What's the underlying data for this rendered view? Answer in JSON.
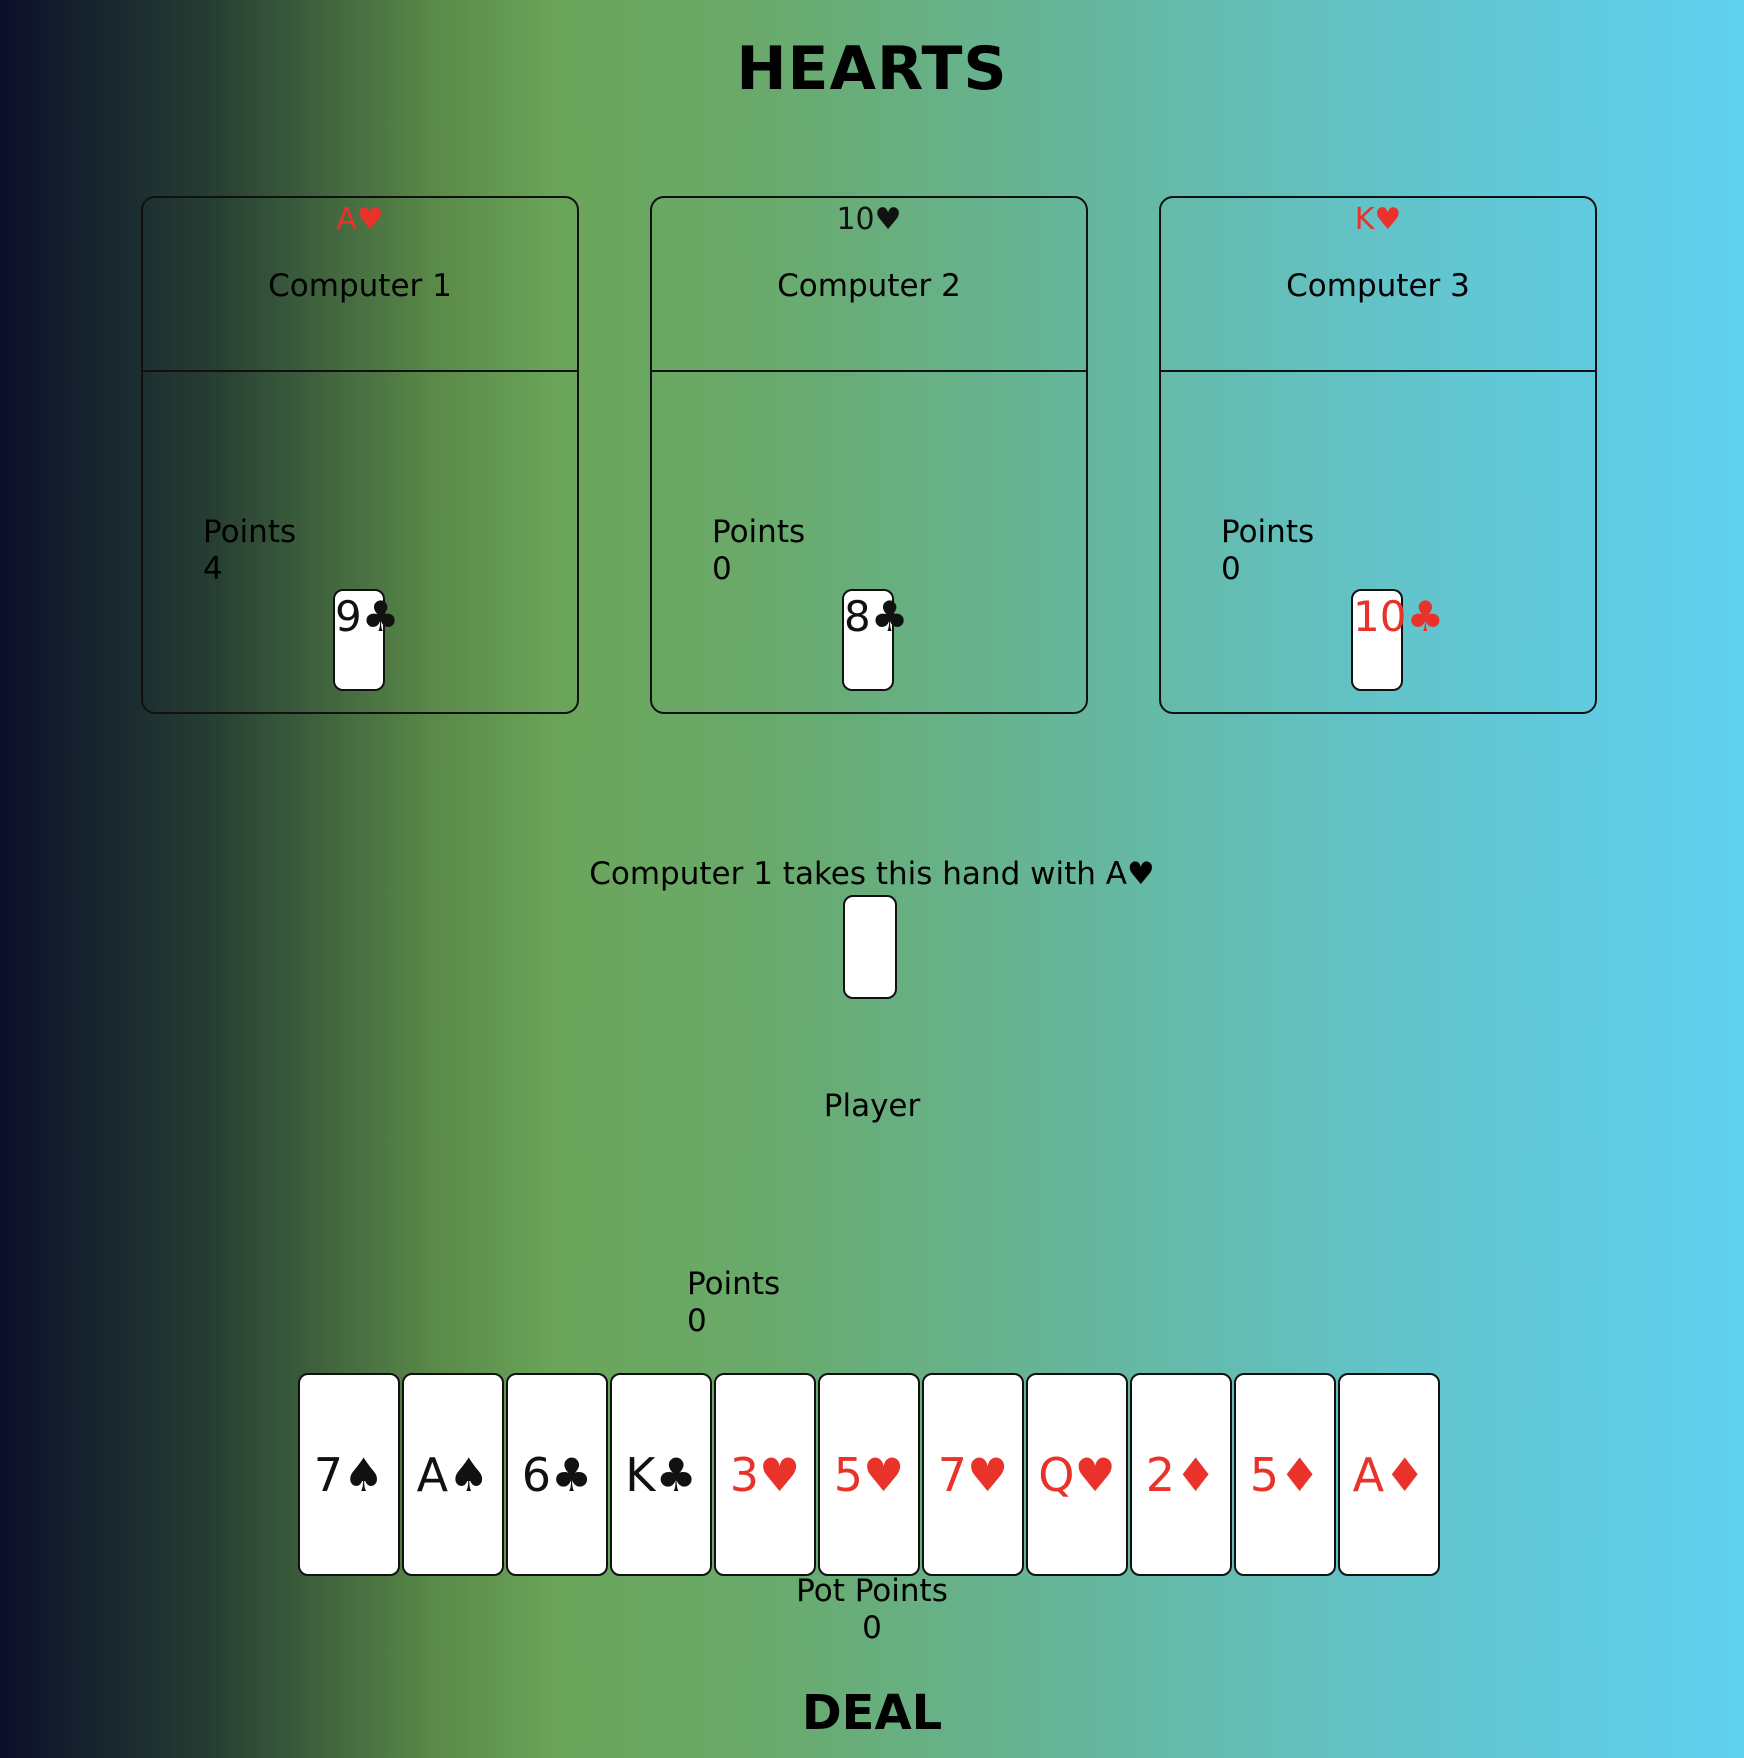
{
  "title": "HEARTS",
  "computers": [
    {
      "name": "Computer 1",
      "played_card": "A♥",
      "played_color": "red",
      "points_label": "Points",
      "points": "4",
      "card": "9♣",
      "card_color": "black"
    },
    {
      "name": "Computer 2",
      "played_card": "10♥",
      "played_color": "black",
      "points_label": "Points",
      "points": "0",
      "card": "8♣",
      "card_color": "black"
    },
    {
      "name": "Computer 3",
      "played_card": "K♥",
      "played_color": "red",
      "points_label": "Points",
      "points": "0",
      "card": "10♣",
      "card_color": "red"
    }
  ],
  "message": "Computer 1 takes this hand with A♥",
  "player": {
    "label": "Player",
    "points_label": "Points",
    "points": "0",
    "hand": [
      {
        "label": "7♠",
        "color": "black"
      },
      {
        "label": "A♠",
        "color": "black"
      },
      {
        "label": "6♣",
        "color": "black"
      },
      {
        "label": "K♣",
        "color": "black"
      },
      {
        "label": "3♥",
        "color": "red"
      },
      {
        "label": "5♥",
        "color": "red"
      },
      {
        "label": "7♥",
        "color": "red"
      },
      {
        "label": "Q♥",
        "color": "red"
      },
      {
        "label": "2♦",
        "color": "red"
      },
      {
        "label": "5♦",
        "color": "red"
      },
      {
        "label": "A♦",
        "color": "red"
      }
    ]
  },
  "pot": {
    "label": "Pot Points",
    "value": "0"
  },
  "deal_label": "DEAL",
  "colors": {
    "red": "#e8322a",
    "black": "#111111"
  }
}
